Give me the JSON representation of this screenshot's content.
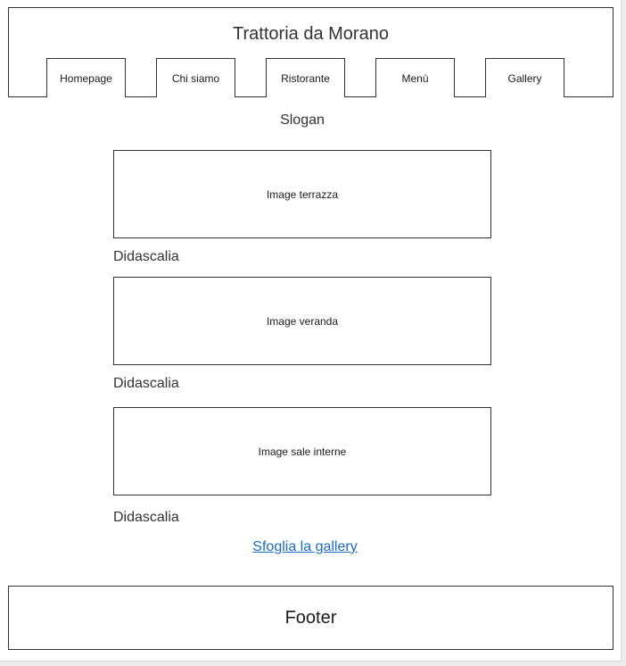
{
  "header": {
    "title": "Trattoria da Morano",
    "nav": [
      "Homepage",
      "Chi siamo",
      "Ristorante",
      "Menù",
      "Gallery"
    ]
  },
  "slogan": "Slogan",
  "images": [
    {
      "label": "Image terrazza",
      "caption": "Didascalia"
    },
    {
      "label": "Image veranda",
      "caption": "Didascalia"
    },
    {
      "label": "Image sale interne",
      "caption": "Didascalia"
    }
  ],
  "gallery_link": "Sfoglia la gallery",
  "footer": "Footer",
  "colors": {
    "link": "#1a6bc0",
    "border": "#333333",
    "background": "#ffffff"
  }
}
